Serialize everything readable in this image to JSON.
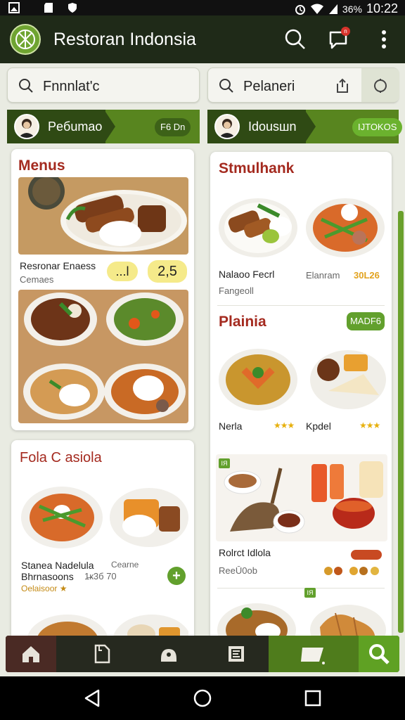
{
  "status_bar": {
    "battery": "36%",
    "time": "10:22"
  },
  "app_bar": {
    "title": "Restoran Indonsia",
    "notification_count": "n"
  },
  "search_left": {
    "value": "Fnnnlat'c"
  },
  "search_right": {
    "value": "Pelaneri"
  },
  "left_header": {
    "name": "Peбumao",
    "badge": "F6 Dn"
  },
  "right_header": {
    "name": "Idousшn",
    "badge": "IJTOKOS"
  },
  "left_card1": {
    "title": "Menus",
    "item_name": "Resronar Enaess",
    "item_sub": "Cemaes",
    "qty": "...l",
    "price": "2,5"
  },
  "left_card2": {
    "title": "Fola C asiola",
    "item_name": "Stanea Nadelula",
    "item_name2": "Bhrnasoons",
    "item_meta": "1̶к3б  70",
    "item_side": "Cearne",
    "item_sub": "Oelaisoor ★",
    "add_label": "+"
  },
  "right_card": {
    "title": "Stmulhank",
    "dish1_name": "Nalaoo Fecrl",
    "dish1_sub": "Fangeoll",
    "dish2_name": "Elanram",
    "dish2_price": "30L26",
    "section2_title": "Plainia",
    "section2_badge": "MADF6",
    "dish3_name": "Nerla",
    "dish3_rating": "★★★",
    "dish4_name": "Kpdel",
    "dish4_rating": "★★★",
    "section3_tag": "IЯ",
    "dish5_name": "Rolrct Idlola",
    "dish5_sub": "ReeŪ0ob",
    "section4_tag": "IЯ"
  },
  "colors": {
    "brand_green": "#58851f",
    "dark_green": "#2f4a14",
    "title_red": "#a42a1f",
    "accent_yellow": "#f5ea8a"
  },
  "icons": [
    "home-icon",
    "document-icon",
    "shop-icon",
    "list-icon",
    "cart-icon",
    "search-icon"
  ]
}
